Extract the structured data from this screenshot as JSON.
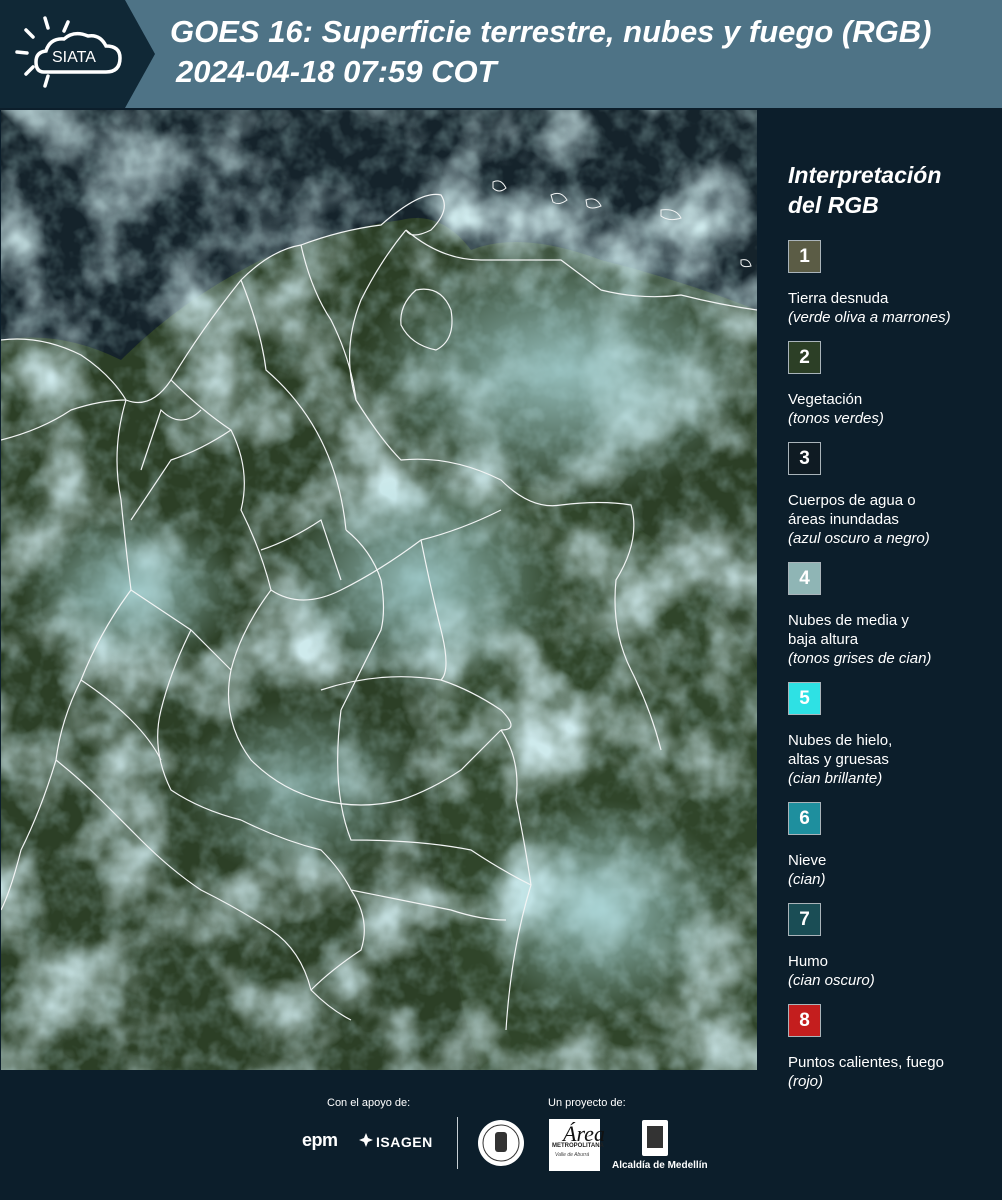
{
  "header": {
    "logo_text": "SIATA",
    "title_line1": "GOES 16: Superficie terrestre, nubes y fuego (RGB)",
    "title_line2": "2024-04-18 07:59 COT"
  },
  "legend": {
    "title_line1": "Interpretación",
    "title_line2": "del RGB",
    "items": [
      {
        "number": "1",
        "color": "#5b5c45",
        "lines": [
          "Tierra desnuda"
        ],
        "sub": "(verde oliva a marrones)"
      },
      {
        "number": "2",
        "color": "#2c3f26",
        "lines": [
          "Vegetación"
        ],
        "sub": "(tonos verdes)"
      },
      {
        "number": "3",
        "color": "#0f1b23",
        "lines": [
          "Cuerpos de agua o",
          "áreas inundadas"
        ],
        "sub": "(azul oscuro a negro)"
      },
      {
        "number": "4",
        "color": "#8fb5b5",
        "lines": [
          "Nubes de media y",
          "baja altura"
        ],
        "sub": "(tonos grises de cian)"
      },
      {
        "number": "5",
        "color": "#2ee1e4",
        "lines": [
          "Nubes de hielo,",
          "altas y gruesas"
        ],
        "sub": "(cian brillante)"
      },
      {
        "number": "6",
        "color": "#1e8f9e",
        "lines": [
          "Nieve"
        ],
        "sub": "(cian)"
      },
      {
        "number": "7",
        "color": "#1a4d55",
        "lines": [
          "Humo"
        ],
        "sub": "(cian oscuro)"
      },
      {
        "number": "8",
        "color": "#c41e1e",
        "lines": [
          "Puntos calientes, fuego"
        ],
        "sub": "(rojo)"
      }
    ]
  },
  "footer": {
    "support_label": "Con el apoyo de:",
    "project_label": "Un proyecto de:",
    "epm": "epm",
    "isagen": "ISAGEN",
    "area_mark": "Área",
    "area_name": "METROPOLITANA",
    "area_sub": "Valle de Aburrá",
    "alcaldia": "Alcaldía de Medellín"
  },
  "colors": {
    "header_bg": "#4e7386",
    "page_bg": "#0c1e2b",
    "land_veg": "#2c3f26",
    "cloud_cyan": "#9ccfd2"
  }
}
